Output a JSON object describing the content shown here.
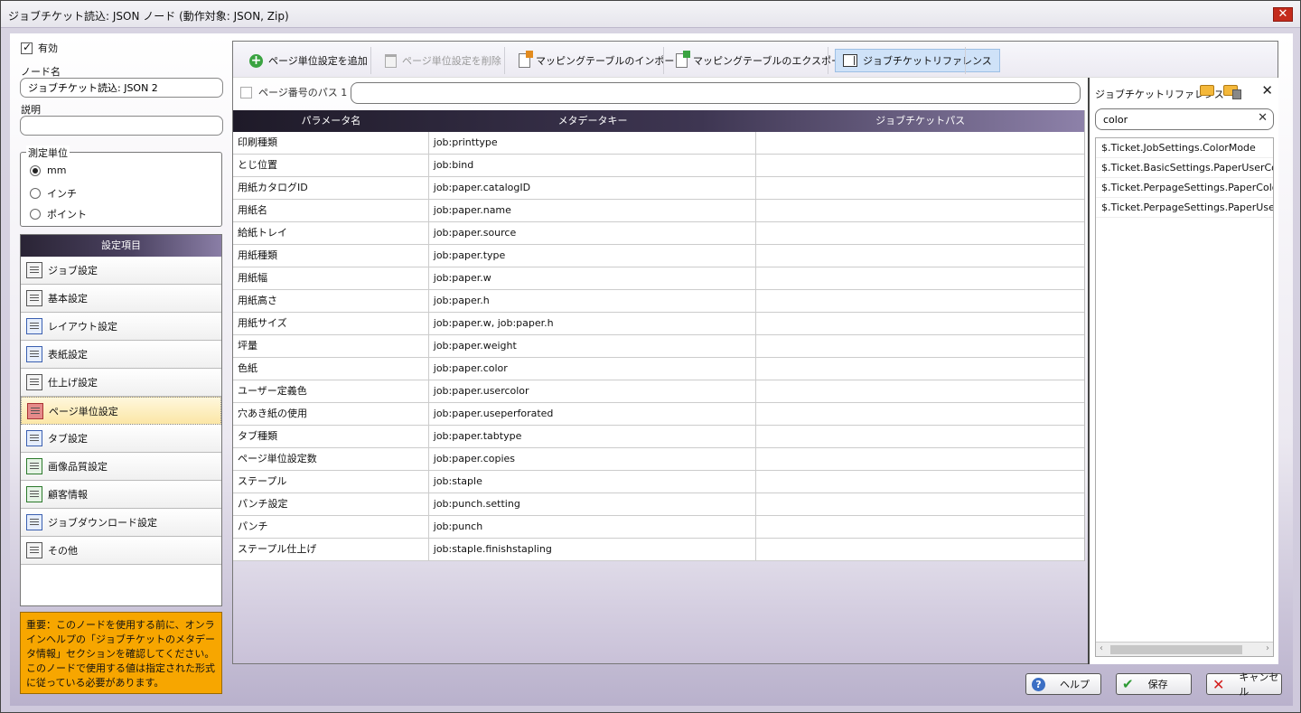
{
  "window": {
    "title": "ジョブチケット読込: JSON ノード (動作対象: JSON, Zip)",
    "close": "✕"
  },
  "left": {
    "enabled_label": "有効",
    "node_name_label": "ノード名",
    "node_name_value": "ジョブチケット読込: JSON 2",
    "description_label": "説明",
    "description_value": "",
    "unit_legend": "測定単位",
    "units": [
      "mm",
      "インチ",
      "ポイント"
    ],
    "settings_header": "設定項目",
    "settings_items": [
      "ジョブ設定",
      "基本設定",
      "レイアウト設定",
      "表紙設定",
      "仕上げ設定",
      "ページ単位設定",
      "タブ設定",
      "画像品質設定",
      "顧客情報",
      "ジョブダウンロード設定",
      "その他"
    ],
    "warning": "重要：このノードを使用する前に、オンラインヘルプの「ジョブチケットのメタデータ情報」セクションを確認してください。このノードで使用する値は指定された形式に従っている必要があります。"
  },
  "toolbar": {
    "add": "ページ単位設定を追加",
    "delete": "ページ単位設定を削除",
    "import": "マッピングテーブルのインポート",
    "export": "マッピングテーブルのエクスポート",
    "reference": "ジョブチケットリファレンス"
  },
  "path": {
    "label": "ページ番号のパス 1",
    "value": ""
  },
  "table": {
    "headers": [
      "パラメータ名",
      "メタデータキー",
      "ジョブチケットパス"
    ],
    "rows": [
      [
        "印刷種類",
        "job:printtype",
        ""
      ],
      [
        "とじ位置",
        "job:bind",
        ""
      ],
      [
        "用紙カタログID",
        "job:paper.catalogID",
        ""
      ],
      [
        "用紙名",
        "job:paper.name",
        ""
      ],
      [
        "給紙トレイ",
        "job:paper.source",
        ""
      ],
      [
        "用紙種類",
        "job:paper.type",
        ""
      ],
      [
        "用紙幅",
        "job:paper.w",
        ""
      ],
      [
        "用紙高さ",
        "job:paper.h",
        ""
      ],
      [
        "用紙サイズ",
        "job:paper.w, job:paper.h",
        ""
      ],
      [
        "坪量",
        "job:paper.weight",
        ""
      ],
      [
        "色紙",
        "job:paper.color",
        ""
      ],
      [
        "ユーザー定義色",
        "job:paper.usercolor",
        ""
      ],
      [
        "穴あき紙の使用",
        "job:paper.useperforated",
        ""
      ],
      [
        "タブ種類",
        "job:paper.tabtype",
        ""
      ],
      [
        "ページ単位設定数",
        "job:paper.copies",
        ""
      ],
      [
        "ステープル",
        "job:staple",
        ""
      ],
      [
        "パンチ設定",
        "job:punch.setting",
        ""
      ],
      [
        "パンチ",
        "job:punch",
        ""
      ],
      [
        "ステープル仕上げ",
        "job:staple.finishstapling",
        ""
      ]
    ]
  },
  "reference": {
    "title": "ジョブチケットリファレンス",
    "search_value": "color",
    "items": [
      "$.Ticket.JobSettings.ColorMode",
      "$.Ticket.BasicSettings.PaperUserColor",
      "$.Ticket.PerpageSettings.PaperColor",
      "$.Ticket.PerpageSettings.PaperUserColor"
    ]
  },
  "buttons": {
    "help": "ヘルプ",
    "save": "保存",
    "cancel": "キャンセル"
  }
}
